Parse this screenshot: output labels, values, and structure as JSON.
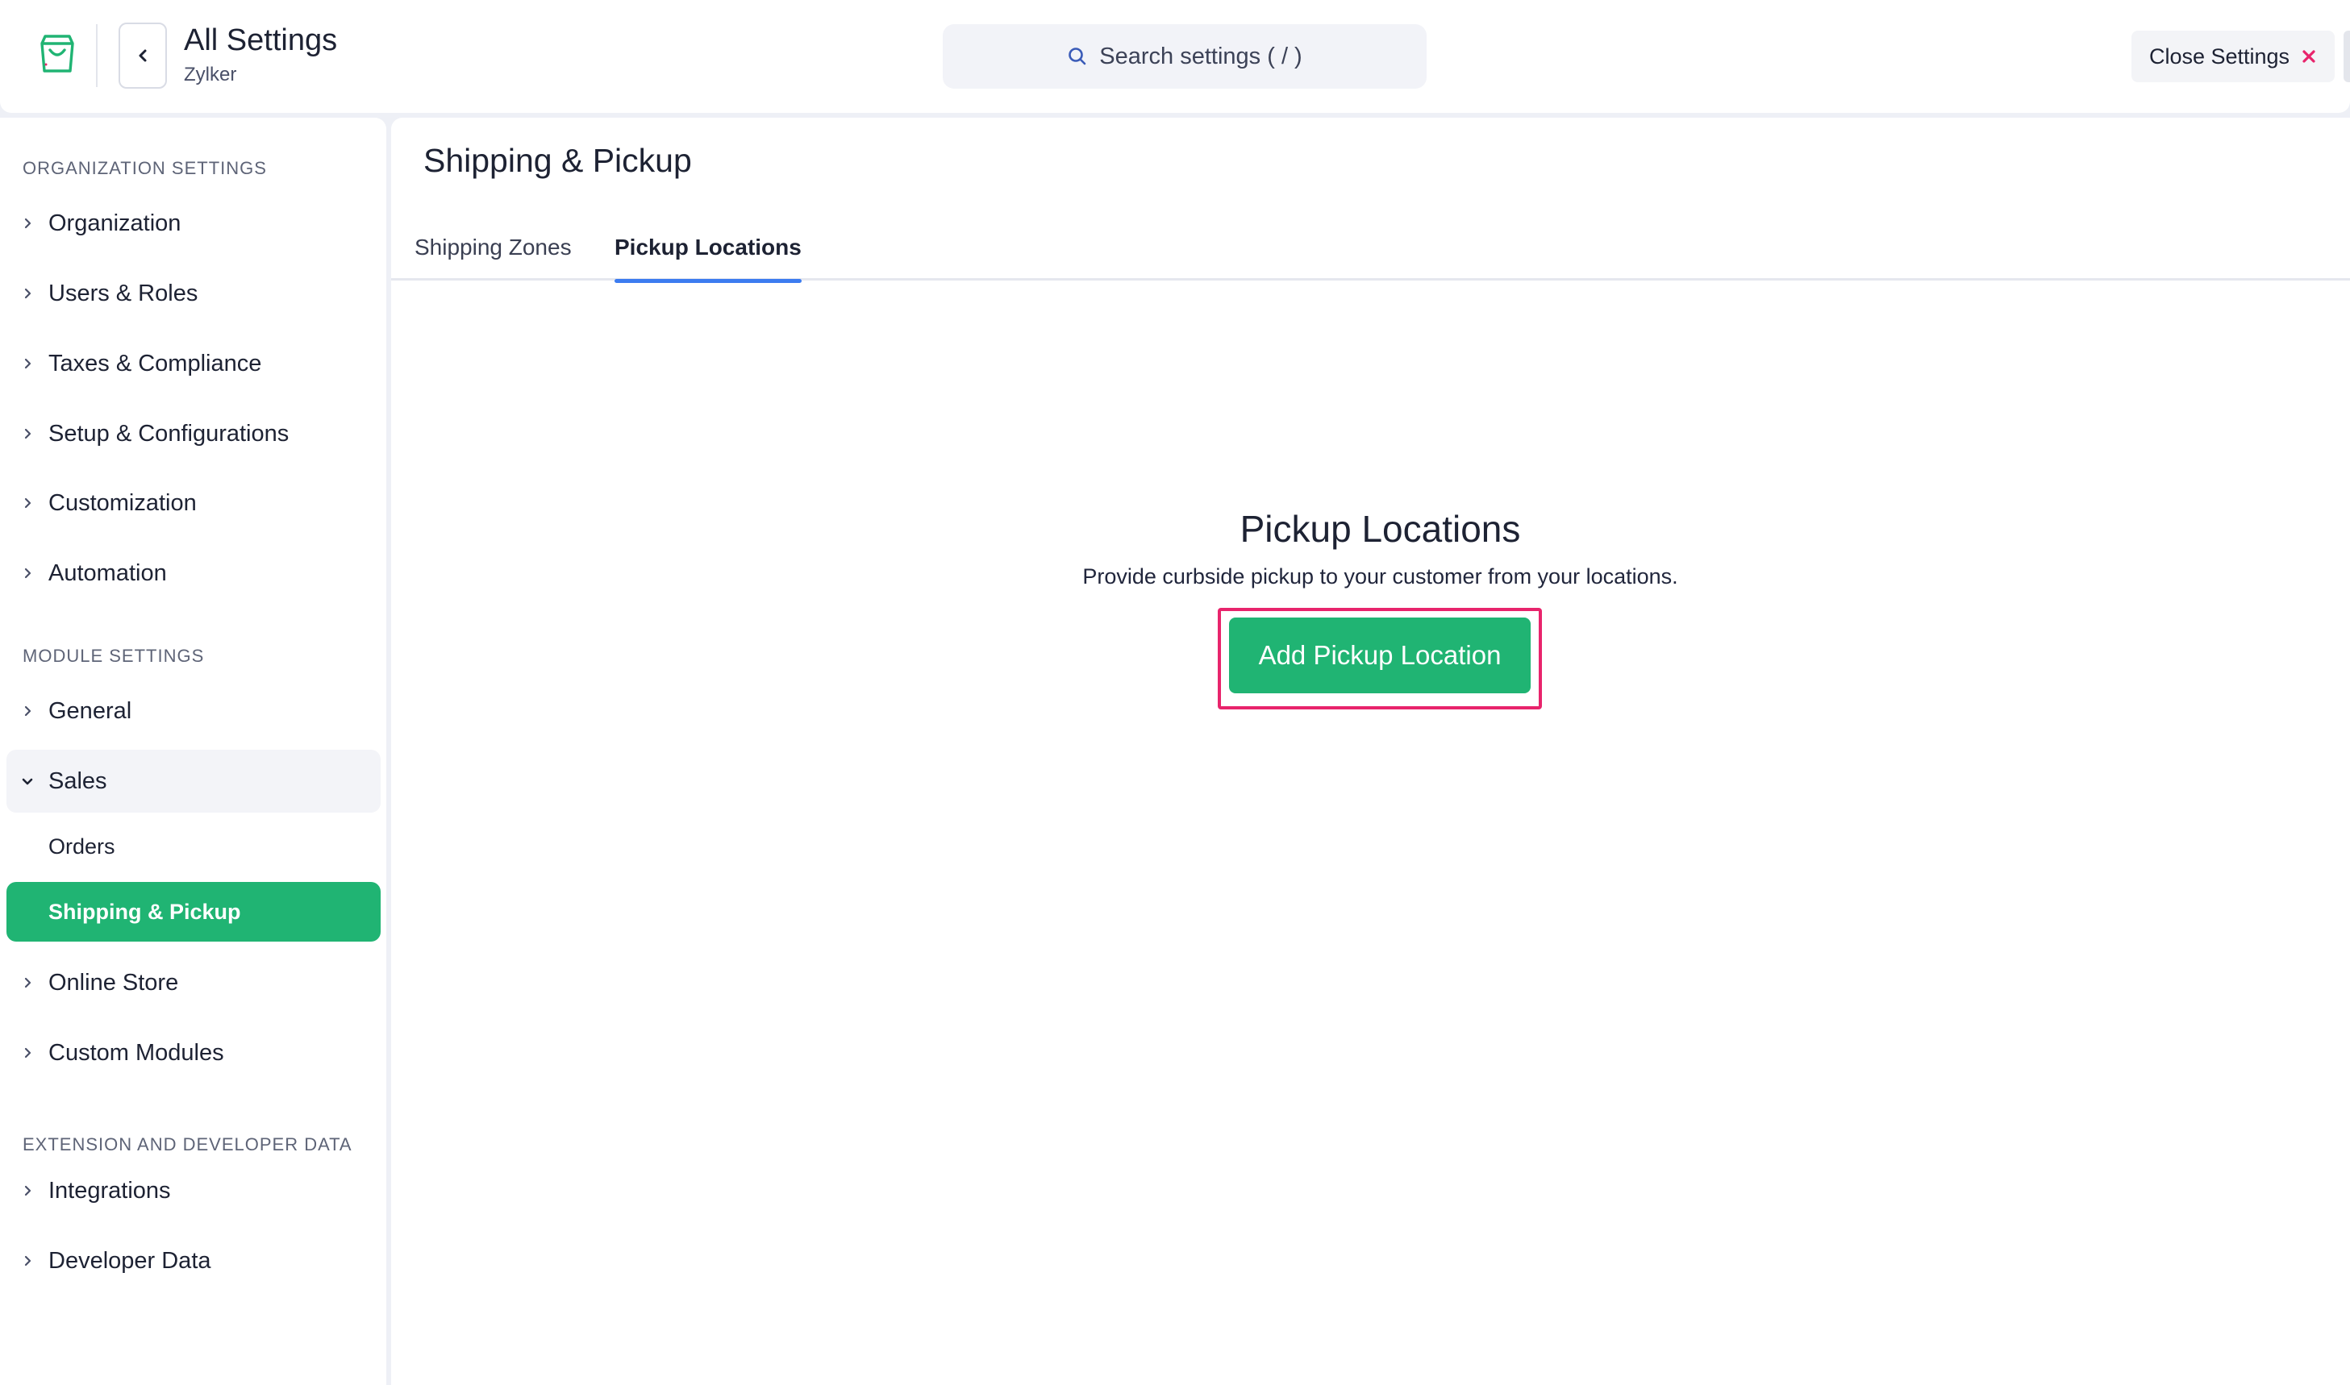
{
  "header": {
    "title": "All Settings",
    "org": "Zylker",
    "search_placeholder": "Search settings ( / )",
    "close_label": "Close Settings"
  },
  "sidebar": {
    "sections": [
      {
        "heading": "ORGANIZATION SETTINGS",
        "items": [
          "Organization",
          "Users & Roles",
          "Taxes & Compliance",
          "Setup & Configurations",
          "Customization",
          "Automation"
        ]
      },
      {
        "heading": "MODULE SETTINGS",
        "items": [
          "General",
          "Sales",
          "Online Store",
          "Custom Modules"
        ],
        "expanded_item": "Sales",
        "sub_items": [
          "Orders",
          "Shipping & Pickup"
        ],
        "active_sub_item": "Shipping & Pickup"
      },
      {
        "heading": "EXTENSION AND DEVELOPER DATA",
        "items": [
          "Integrations",
          "Developer Data"
        ]
      }
    ]
  },
  "main": {
    "title": "Shipping & Pickup",
    "tabs": [
      "Shipping Zones",
      "Pickup Locations"
    ],
    "active_tab": "Pickup Locations",
    "empty_state": {
      "title": "Pickup Locations",
      "description": "Provide curbside pickup to your customer from your locations.",
      "button_label": "Add Pickup Location"
    }
  },
  "colors": {
    "brand_green": "#20b473",
    "tab_underline": "#3c7cf0",
    "highlight_border": "#e8246c",
    "close_icon": "#e8246c"
  },
  "icons": [
    "shopping-bag-icon",
    "chevron-left-icon",
    "search-icon",
    "close-icon",
    "chevron-right-icon",
    "chevron-down-icon"
  ]
}
